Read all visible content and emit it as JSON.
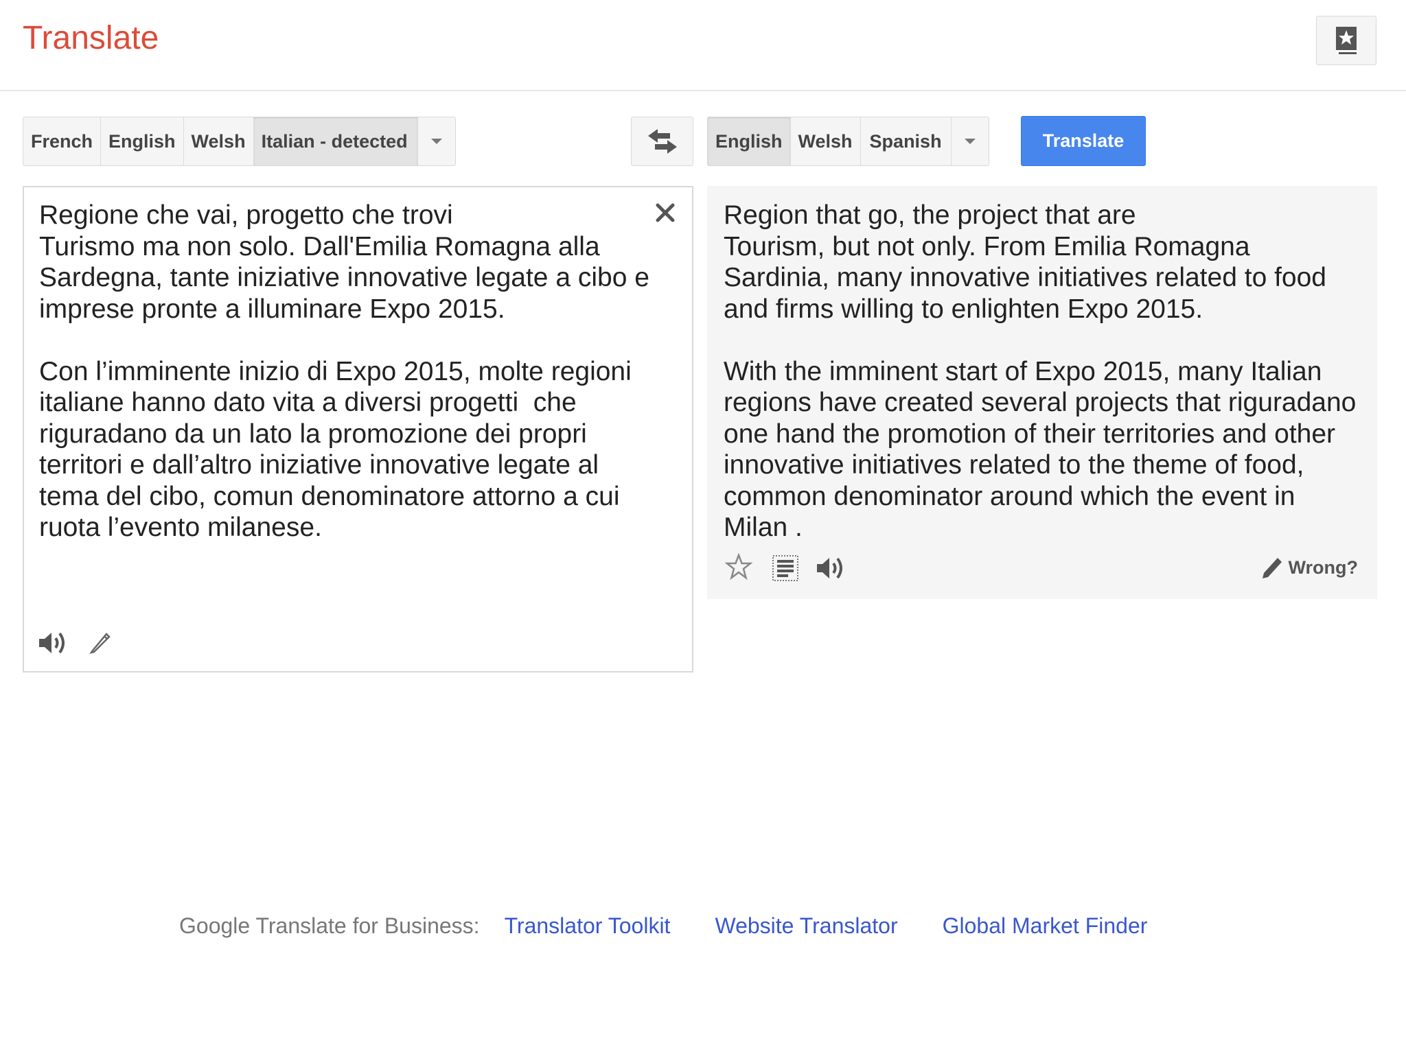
{
  "header": {
    "title": "Translate",
    "phrasebook_icon": "phrasebook-star-icon"
  },
  "source_languages": {
    "items": [
      {
        "label": "French",
        "active": false
      },
      {
        "label": "English",
        "active": false
      },
      {
        "label": "Welsh",
        "active": false
      },
      {
        "label": "Italian - detected",
        "active": true
      }
    ],
    "more_icon": "chevron-down-icon"
  },
  "swap_icon": "swap-arrows-icon",
  "target_languages": {
    "items": [
      {
        "label": "English",
        "active": true
      },
      {
        "label": "Welsh",
        "active": false
      },
      {
        "label": "Spanish",
        "active": false
      }
    ],
    "more_icon": "chevron-down-icon"
  },
  "translate_button": "Translate",
  "source": {
    "text": "Regione che vai, progetto che trovi\nTurismo ma non solo. Dall'Emilia Romagna alla Sardegna, tante iniziative innovative legate a cibo e imprese pronte a illuminare Expo 2015.\n\nCon l’imminente inizio di Expo 2015, molte regioni italiane hanno dato vita a diversi progetti  che riguradano da un lato la promozione dei propri territori e dall’altro iniziative innovative legate al tema del cibo, comun denominatore attorno a cui ruota l’evento milanese.",
    "icons": [
      "speaker-icon",
      "pencil-icon",
      "close-icon"
    ]
  },
  "target": {
    "text": "Region that go, the project that are\nTourism, but not only. From Emilia Romagna Sardinia, many innovative initiatives related to food and firms willing to enlighten Expo 2015.\n\nWith the imminent start of Expo 2015, many Italian regions have created several projects that riguradano one hand the promotion of their territories and other innovative initiatives related to the theme of food, common denominator around which the event in Milan .",
    "icons": [
      "star-icon",
      "select-text-icon",
      "speaker-icon"
    ],
    "wrong_label": "Wrong?"
  },
  "footer": {
    "label": "Google Translate for Business:",
    "links": [
      "Translator Toolkit",
      "Website Translator",
      "Global Market Finder"
    ]
  },
  "colors": {
    "brand_red": "#dd4b39",
    "button_blue": "#4787ed",
    "link_blue": "#3957cc"
  }
}
